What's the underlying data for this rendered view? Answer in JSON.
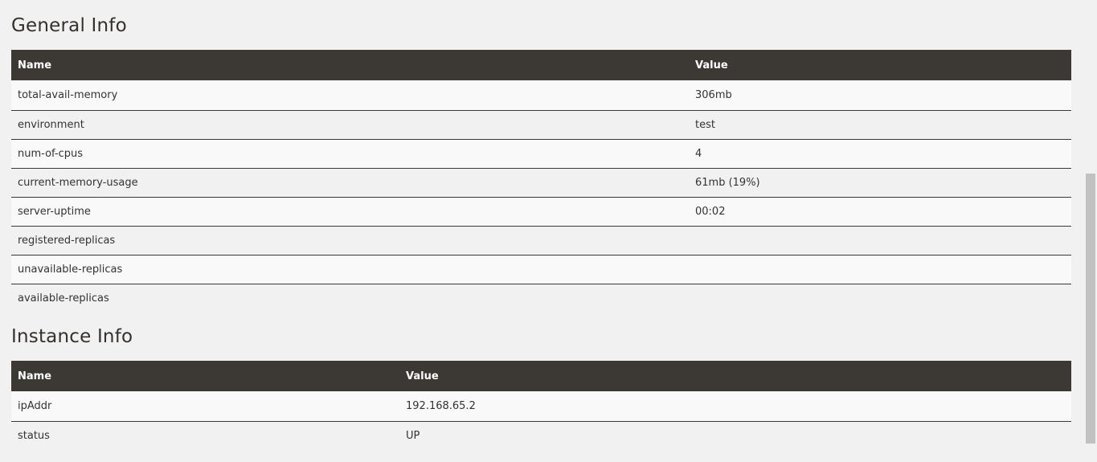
{
  "general": {
    "title": "General Info",
    "columns": [
      "Name",
      "Value"
    ],
    "rows": [
      {
        "name": "total-avail-memory",
        "value": "306mb"
      },
      {
        "name": "environment",
        "value": "test"
      },
      {
        "name": "num-of-cpus",
        "value": "4"
      },
      {
        "name": "current-memory-usage",
        "value": "61mb (19%)"
      },
      {
        "name": "server-uptime",
        "value": "00:02"
      },
      {
        "name": "registered-replicas",
        "value": ""
      },
      {
        "name": "unavailable-replicas",
        "value": ""
      },
      {
        "name": "available-replicas",
        "value": ""
      }
    ]
  },
  "instance": {
    "title": "Instance Info",
    "columns": [
      "Name",
      "Value"
    ],
    "rows": [
      {
        "name": "ipAddr",
        "value": "192.168.65.2"
      },
      {
        "name": "status",
        "value": "UP"
      }
    ]
  }
}
